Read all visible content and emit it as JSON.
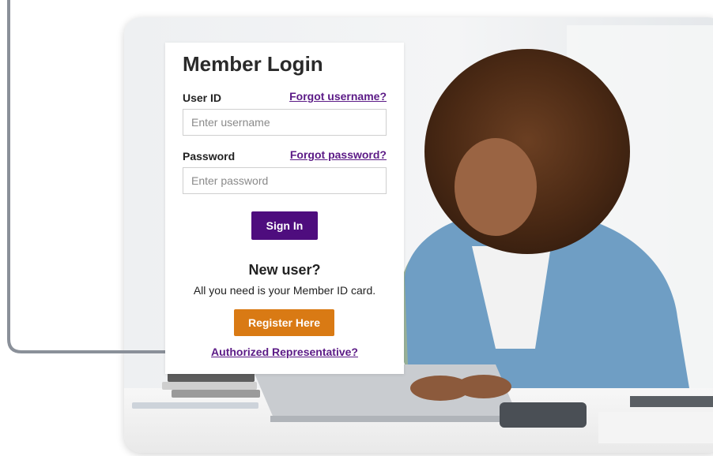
{
  "login": {
    "title": "Member Login",
    "user_id_label": "User ID",
    "forgot_username": "Forgot username?",
    "username_placeholder": "Enter username",
    "password_label": "Password",
    "forgot_password": "Forgot password?",
    "password_placeholder": "Enter password",
    "sign_in": "Sign In",
    "new_user_heading": "New user?",
    "new_user_text": "All you need is your Member ID card.",
    "register": "Register Here",
    "authorized_rep": "Authorized Representative?"
  },
  "colors": {
    "primary_purple": "#4e0d7e",
    "link_purple": "#5b1a86",
    "register_orange": "#d97a14",
    "pointer_gray": "#8a9099"
  },
  "icons": {
    "pointer_arrow": "arrow-right-icon"
  }
}
